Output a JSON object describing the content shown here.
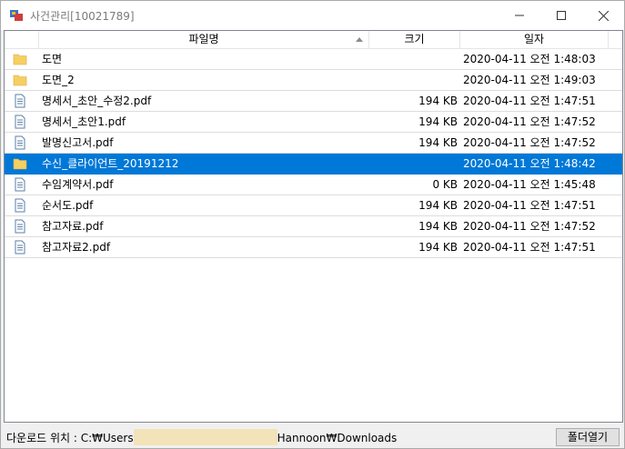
{
  "window": {
    "title": "사건관리[10021789]"
  },
  "columns": {
    "name": "파일명",
    "size": "크기",
    "date": "일자"
  },
  "files": [
    {
      "icon": "folder",
      "name": "도면",
      "size": "",
      "date": "2020-04-11 오전 1:48:03"
    },
    {
      "icon": "folder",
      "name": "도면_2",
      "size": "",
      "date": "2020-04-11 오전 1:49:03"
    },
    {
      "icon": "document",
      "name": "명세서_초안_수정2.pdf",
      "size": "194 KB",
      "date": "2020-04-11 오전 1:47:51"
    },
    {
      "icon": "document",
      "name": "명세서_초안1.pdf",
      "size": "194 KB",
      "date": "2020-04-11 오전 1:47:52"
    },
    {
      "icon": "document",
      "name": "발명신고서.pdf",
      "size": "194 KB",
      "date": "2020-04-11 오전 1:47:52"
    },
    {
      "icon": "folder",
      "name": "수신_클라이언트_20191212",
      "size": "",
      "date": "2020-04-11 오전 1:48:42",
      "selected": true
    },
    {
      "icon": "document",
      "name": "수임계약서.pdf",
      "size": "0 KB",
      "date": "2020-04-11 오전 1:45:48"
    },
    {
      "icon": "document",
      "name": "순서도.pdf",
      "size": "194 KB",
      "date": "2020-04-11 오전 1:47:51"
    },
    {
      "icon": "document",
      "name": "참고자료.pdf",
      "size": "194 KB",
      "date": "2020-04-11 오전 1:47:52"
    },
    {
      "icon": "document",
      "name": "참고자료2.pdf",
      "size": "194 KB",
      "date": "2020-04-11 오전 1:47:51"
    }
  ],
  "status": {
    "path_prefix": "다운로드 위치 : C:₩Users",
    "path_suffix": "Hannoon₩Downloads",
    "open_folder_label": "폴더열기"
  },
  "colors": {
    "selection": "#0078d7",
    "folder": "#f6cf63",
    "redaction": "#f3e3b9"
  }
}
